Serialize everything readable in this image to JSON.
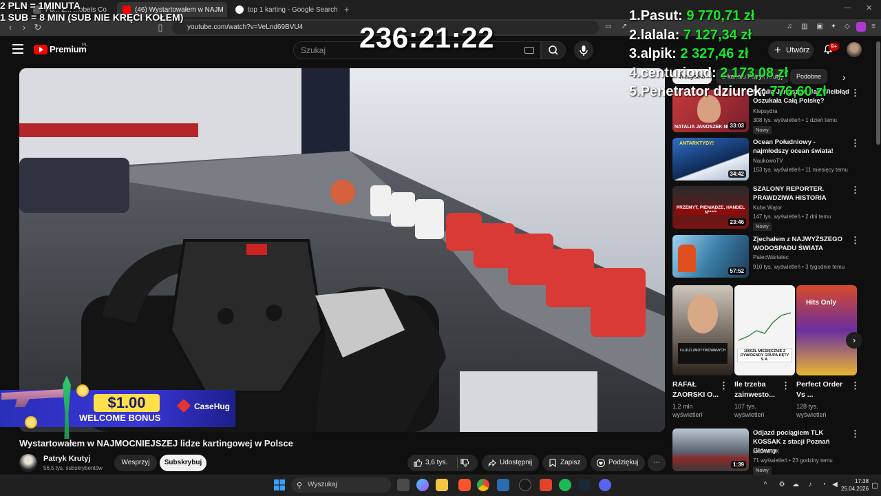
{
  "overlay": {
    "donate_line1": "2 PLN = 1MINUTA",
    "donate_line2": "1 SUB = 8 MIN (SUB NIE KRĘCI KOŁEM)",
    "timer": "236:21:22",
    "leaderboard": [
      {
        "rank": "1.",
        "name": "Pasut:",
        "amount": "9 770,71 zł"
      },
      {
        "rank": "2.",
        "name": "lalala:",
        "amount": "7 127,34 zł"
      },
      {
        "rank": "3.",
        "name": "alpik:",
        "amount": "2 327,46 zł"
      },
      {
        "rank": "4.",
        "name": "centuriond:",
        "amount": "2 173,08 zł"
      },
      {
        "rank": "5.",
        "name": "Penetrator dziurek:",
        "amount": "776,60 zł"
      }
    ],
    "bonus_amount": "$1.00",
    "bonus_label": "WELCOME BONUS",
    "bonus_brand": "CaseHug"
  },
  "browser": {
    "tabs": [
      {
        "label": "Pb...  Z...  ...obets Co",
        "fav_color": "#5b5b5b"
      },
      {
        "label": "(46) Wystartowałem w NAJM",
        "fav_color": "#ff0000"
      },
      {
        "label": "top 1 karting - Google Search",
        "fav_color": "#4285f4"
      }
    ],
    "new_tab": "+",
    "url": "youtube.com/watch?v=VeLnd69BVU4"
  },
  "youtube": {
    "logo_text": "Premium",
    "logo_region": "PL",
    "search_placeholder": "Szukaj",
    "create_label": "Utwórz",
    "notif_count": "9+"
  },
  "video": {
    "title": "Wystartowałem w NAJMOCNIEJSZEJ lidze kartingowej w Polsce",
    "channel": "Patryk Krutyj",
    "subscribers": "56,5 tys. subskrybentów",
    "support_label": "Wesprzyj",
    "subscribe_label": "Subskrybuj",
    "likes": "3,6 tys.",
    "share_label": "Udostępnij",
    "save_label": "Zapisz",
    "thanks_label": "Podziękuj",
    "more_label": "⋯"
  },
  "sidebar": {
    "chips": [
      "Wszystko",
      "Z kanału Patryk Krutyj",
      "Podobne"
    ],
    "videos": [
      {
        "title": "Natalia Janoszek: Jak Wielbłąd Oszukała Całą Polskę?",
        "channel": "Klepsydra",
        "meta": "308 tys. wyświetleń • 1 dzień temu",
        "duration": "33:03",
        "badge": "Nowy",
        "thumb_text": "NATALIA JANOSZEK NI"
      },
      {
        "title": "Ocean Południowy - najmłodszy ocean świata!",
        "channel": "NaukowoTV",
        "meta": "153 tys. wyświetleń • 11 miesięcy temu",
        "duration": "34:42",
        "badge": "",
        "thumb_text": "ANTARKTYDY!"
      },
      {
        "title": "SZALONY REPORTER. PRAWDZIWA HISTORIA",
        "channel": "Kuba Wątor",
        "meta": "147 tys. wyświetleń • 2 dni temu",
        "duration": "23:46",
        "badge": "Nowy",
        "thumb_text": "PRZEMYT, PIENIĄDZE, HANDEL N*****"
      },
      {
        "title": "Zjechałem z NAJWYŻSZEGO WODOSPADU ŚWIATA",
        "channel": "PatecWariatec",
        "meta": "910 tys. wyświetleń • 3 tygodnie temu",
        "duration": "57:52",
        "badge": "",
        "thumb_text": ""
      },
      {
        "title": "Odjazd pociągiem TLK KOSSAK z stacji Poznań Główny",
        "channel": "Hubert MK",
        "meta": "71 wyświetleń • 23 godziny temu",
        "duration": "1:39",
        "badge": "Nowy",
        "thumb_text": ""
      }
    ],
    "shorts": [
      {
        "title": "RAFAŁ ZAORSKI O...",
        "views": "1,2 mln wyświetleń",
        "thumb_text": "I LUDZI ZMOTYWOWANYCH"
      },
      {
        "title": "Ile trzeba zainwesto...",
        "views": "107 tys. wyświetleń",
        "thumb_text": "1000ZŁ MIESIĘCZNIE Z DYWIDENDY GRUPA KĘTY S.A."
      },
      {
        "title": "Perfect Order Vs ...",
        "views": "128 tys. wyświetleń",
        "thumb_text": "Hits Only"
      }
    ]
  },
  "taskbar": {
    "search_placeholder": "Wyszukaj",
    "time": "17:38",
    "date": "25.04.2026"
  }
}
